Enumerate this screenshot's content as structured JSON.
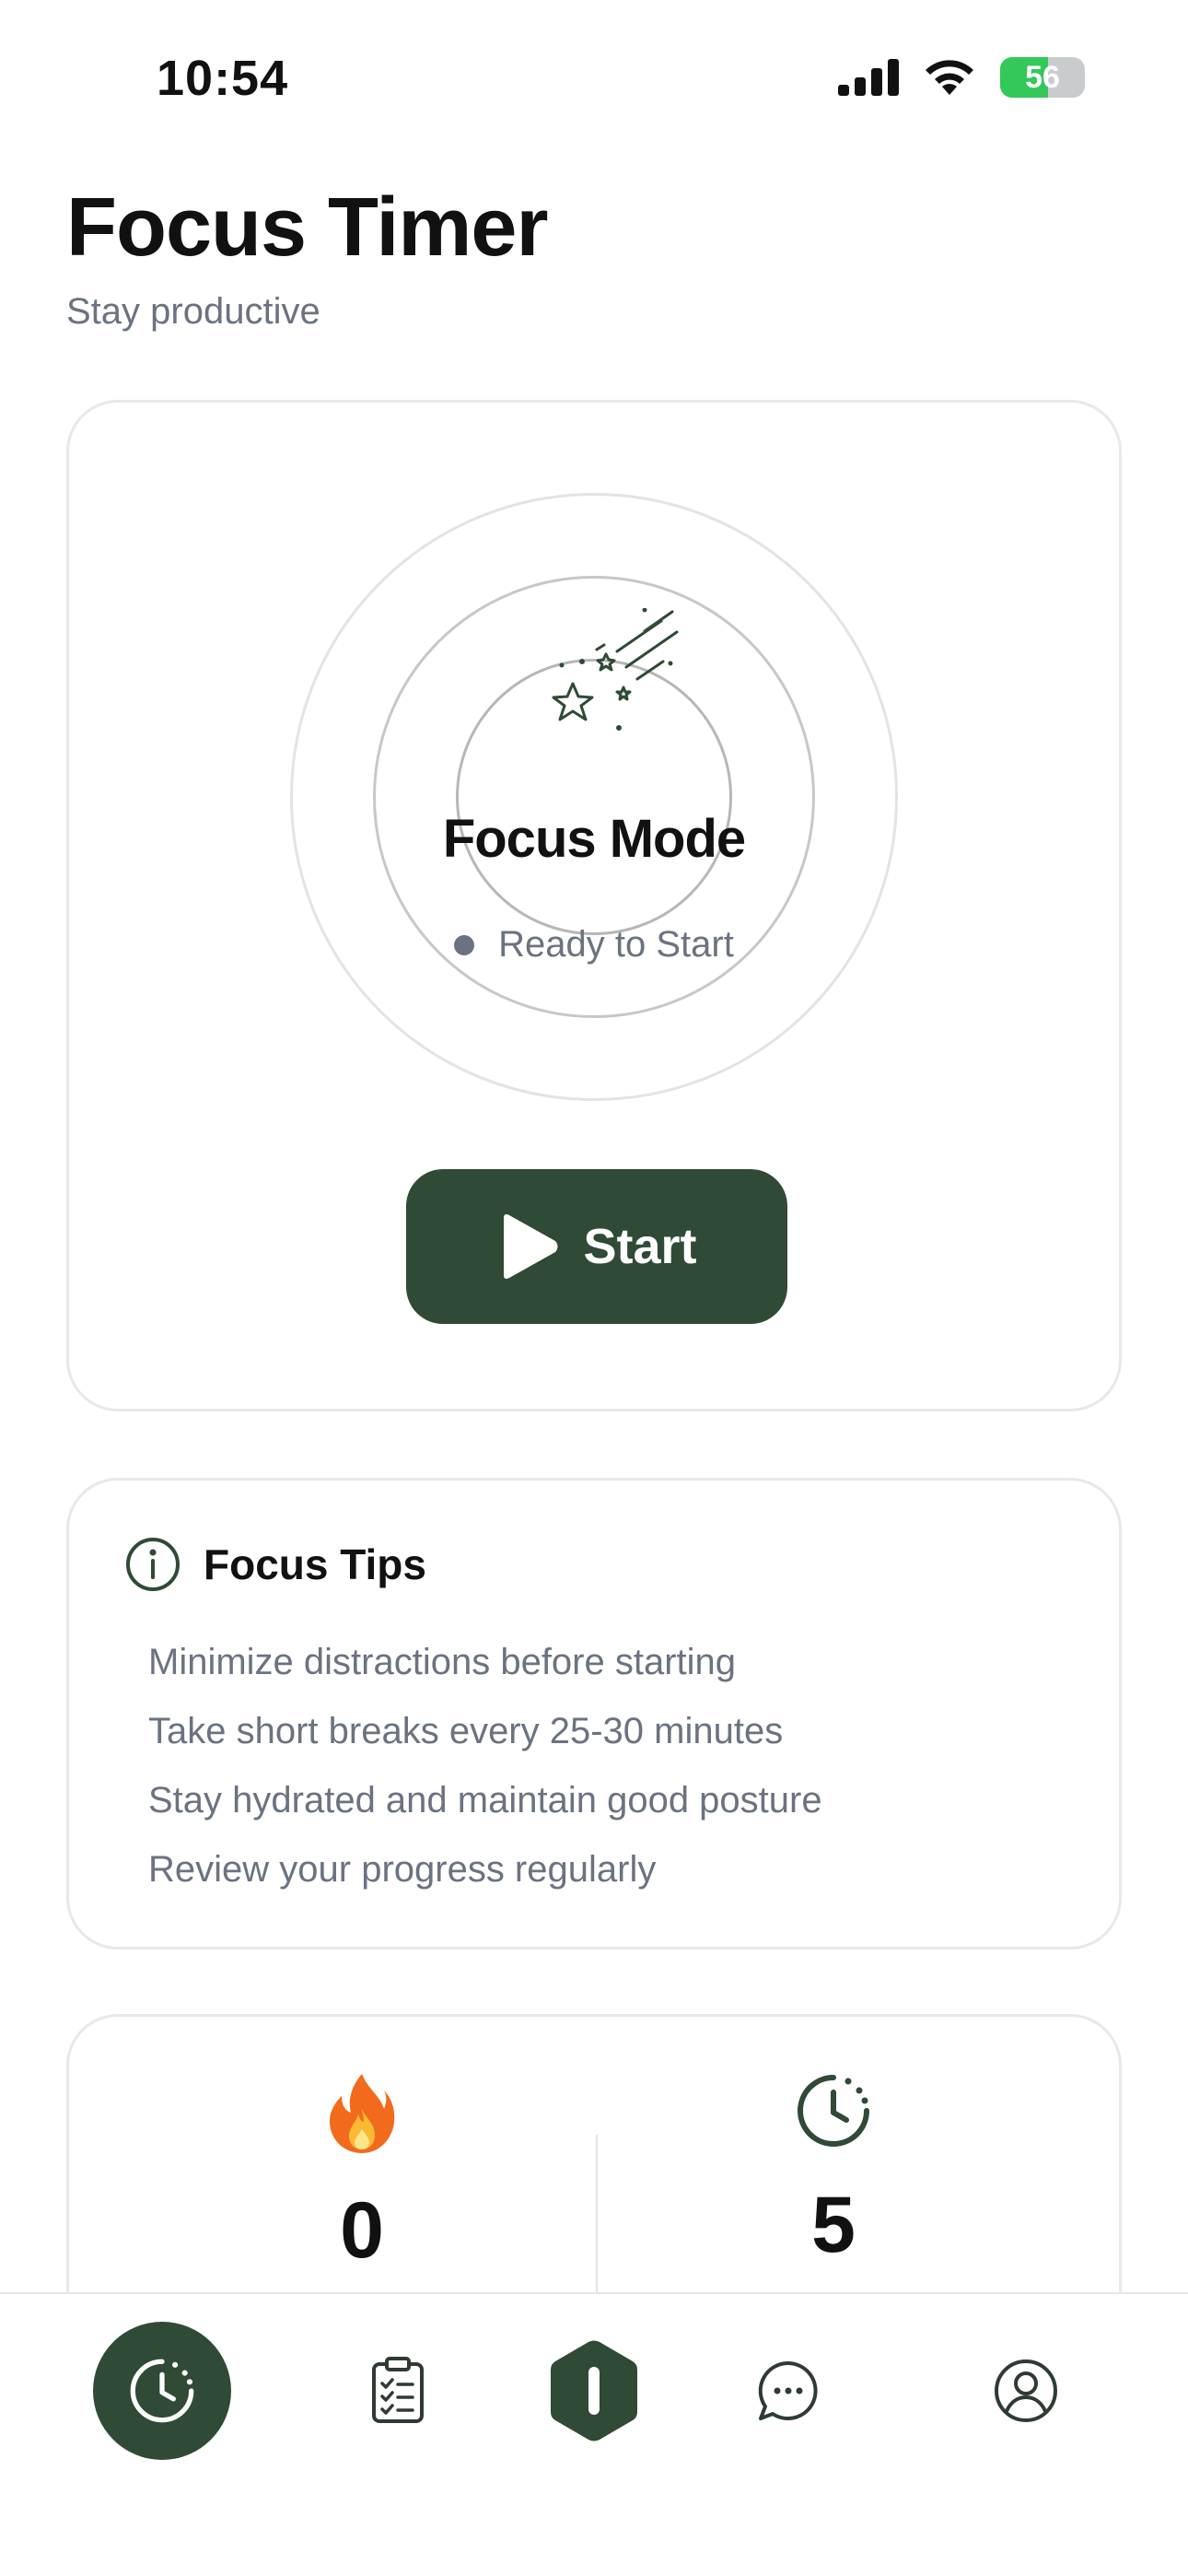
{
  "status_bar": {
    "time": "10:54",
    "battery": "56"
  },
  "header": {
    "title": "Focus Timer",
    "subtitle": "Stay productive"
  },
  "timer": {
    "mode_label": "Focus Mode",
    "status": "Ready to Start",
    "start_label": "Start"
  },
  "tips": {
    "title": "Focus Tips",
    "items": [
      "Minimize distractions before starting",
      "Take short breaks every 25-30 minutes",
      "Stay hydrated and maintain good posture",
      "Review your progress regularly"
    ]
  },
  "stats": [
    {
      "icon": "fire-icon",
      "value": "0"
    },
    {
      "icon": "clock-icon",
      "value": "5"
    }
  ],
  "tabs": [
    {
      "icon": "timer-icon",
      "active": true
    },
    {
      "icon": "clipboard-checklist-icon",
      "active": false
    },
    {
      "icon": "hexagon-focus-icon",
      "active": false
    },
    {
      "icon": "chat-bubble-icon",
      "active": false
    },
    {
      "icon": "profile-icon",
      "active": false
    }
  ],
  "colors": {
    "accent": "#2f4a35",
    "muted_text": "#6b7280",
    "battery_green": "#34c759"
  }
}
